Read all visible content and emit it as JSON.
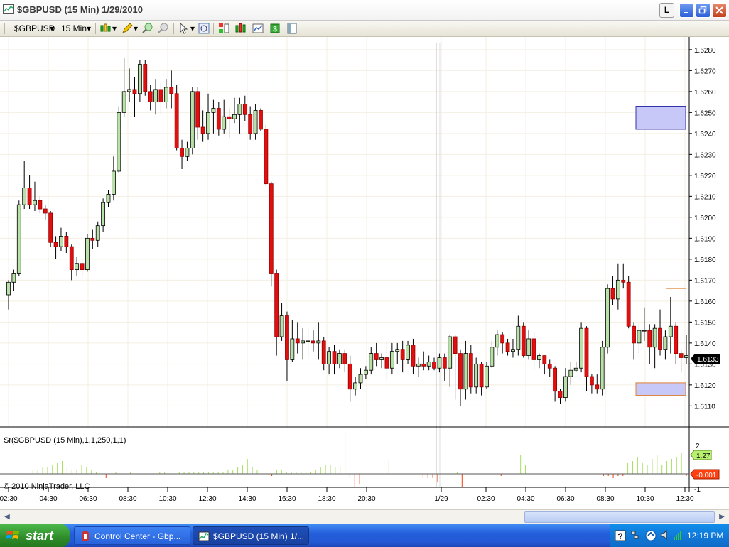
{
  "window": {
    "title": "$GBPUSD (15 Min)  1/29/2010",
    "btn_l": "L"
  },
  "toolbar": {
    "instrument": "$GBPUSD",
    "interval": "15 Min"
  },
  "indicator": {
    "label": "Sr($GBPUSD (15 Min),1,1,250,1,1)",
    "copyright": "© 2010 NinjaTrader, LLC",
    "axis_labels": [
      "2",
      "0",
      "-1"
    ],
    "upper_value": "1.27",
    "lower_value": "-0.001"
  },
  "price_axis": {
    "labels": [
      "1.6280",
      "1.6270",
      "1.6260",
      "1.6250",
      "1.6240",
      "1.6230",
      "1.6220",
      "1.6210",
      "1.6200",
      "1.6190",
      "1.6180",
      "1.6170",
      "1.6160",
      "1.6150",
      "1.6140",
      "1.6130",
      "1.6120",
      "1.6110"
    ],
    "current_price": "1.6133"
  },
  "time_axis": {
    "labels": [
      "02:30",
      "04:30",
      "06:30",
      "08:30",
      "10:30",
      "12:30",
      "14:30",
      "16:30",
      "18:30",
      "20:30",
      "1/29",
      "02:30",
      "04:30",
      "06:30",
      "08:30",
      "10:30",
      "12:30"
    ]
  },
  "chart_data": {
    "type": "candlestick",
    "y_range": [
      1.6103,
      1.6283
    ],
    "up_color": "#B8E0A8",
    "down_color": "#E01010",
    "candles": [
      [
        1.6163,
        1.6169,
        1.6156,
        1.617
      ],
      [
        1.6169,
        1.6173,
        1.6165,
        1.6175
      ],
      [
        1.6173,
        1.6206,
        1.6172,
        1.6208
      ],
      [
        1.6206,
        1.6214,
        1.6204,
        1.6227
      ],
      [
        1.6214,
        1.6206,
        1.6204,
        1.622
      ],
      [
        1.6206,
        1.6208,
        1.6203,
        1.6217
      ],
      [
        1.6208,
        1.6204,
        1.6202,
        1.621
      ],
      [
        1.6204,
        1.6202,
        1.6199,
        1.6206
      ],
      [
        1.6202,
        1.6188,
        1.6186,
        1.6203
      ],
      [
        1.6188,
        1.6186,
        1.618,
        1.6191
      ],
      [
        1.6186,
        1.6191,
        1.6184,
        1.6195
      ],
      [
        1.6191,
        1.6186,
        1.6183,
        1.6193
      ],
      [
        1.6186,
        1.6175,
        1.617,
        1.6187
      ],
      [
        1.6175,
        1.6178,
        1.6172,
        1.6181
      ],
      [
        1.6178,
        1.6175,
        1.6172,
        1.618
      ],
      [
        1.6175,
        1.619,
        1.6174,
        1.6192
      ],
      [
        1.619,
        1.6189,
        1.6185,
        1.6194
      ],
      [
        1.6189,
        1.6196,
        1.6186,
        1.6198
      ],
      [
        1.6196,
        1.6207,
        1.6193,
        1.6209
      ],
      [
        1.6207,
        1.6211,
        1.6205,
        1.6213
      ],
      [
        1.6211,
        1.6222,
        1.6208,
        1.6229
      ],
      [
        1.6222,
        1.625,
        1.6221,
        1.6253
      ],
      [
        1.625,
        1.626,
        1.6248,
        1.6276
      ],
      [
        1.626,
        1.6261,
        1.6255,
        1.6271
      ],
      [
        1.6261,
        1.6259,
        1.6248,
        1.6267
      ],
      [
        1.6259,
        1.6273,
        1.6255,
        1.6275
      ],
      [
        1.6273,
        1.626,
        1.6258,
        1.6275
      ],
      [
        1.626,
        1.6255,
        1.6251,
        1.6263
      ],
      [
        1.6255,
        1.6261,
        1.6249,
        1.6266
      ],
      [
        1.6261,
        1.6255,
        1.6249,
        1.6264
      ],
      [
        1.6255,
        1.6262,
        1.6252,
        1.6266
      ],
      [
        1.6262,
        1.6259,
        1.6252,
        1.627
      ],
      [
        1.6259,
        1.6233,
        1.6232,
        1.6263
      ],
      [
        1.6233,
        1.6229,
        1.6223,
        1.6237
      ],
      [
        1.6229,
        1.6233,
        1.6227,
        1.6236
      ],
      [
        1.6233,
        1.626,
        1.623,
        1.6262
      ],
      [
        1.626,
        1.6243,
        1.6237,
        1.6262
      ],
      [
        1.6243,
        1.624,
        1.6236,
        1.6251
      ],
      [
        1.624,
        1.625,
        1.6237,
        1.6259
      ],
      [
        1.625,
        1.6252,
        1.624,
        1.6256
      ],
      [
        1.6252,
        1.6242,
        1.6239,
        1.6255
      ],
      [
        1.6242,
        1.6248,
        1.624,
        1.6256
      ],
      [
        1.6248,
        1.6247,
        1.6238,
        1.6252
      ],
      [
        1.6247,
        1.6249,
        1.6245,
        1.6257
      ],
      [
        1.6249,
        1.6254,
        1.624,
        1.6257
      ],
      [
        1.6254,
        1.6249,
        1.6246,
        1.6258
      ],
      [
        1.6249,
        1.624,
        1.6237,
        1.6253
      ],
      [
        1.624,
        1.6251,
        1.6237,
        1.6254
      ],
      [
        1.6251,
        1.6242,
        1.6241,
        1.6252
      ],
      [
        1.6242,
        1.6216,
        1.6215,
        1.6244
      ],
      [
        1.6216,
        1.6173,
        1.6167,
        1.6217
      ],
      [
        1.6173,
        1.6143,
        1.6134,
        1.6175
      ],
      [
        1.6143,
        1.6153,
        1.6141,
        1.6159
      ],
      [
        1.6153,
        1.6132,
        1.6122,
        1.6155
      ],
      [
        1.6132,
        1.6142,
        1.6131,
        1.6151
      ],
      [
        1.6142,
        1.614,
        1.6135,
        1.615
      ],
      [
        1.614,
        1.6141,
        1.6132,
        1.6147
      ],
      [
        1.6141,
        1.6141,
        1.6133,
        1.6147
      ],
      [
        1.6141,
        1.614,
        1.6136,
        1.6146
      ],
      [
        1.614,
        1.6141,
        1.6132,
        1.615
      ],
      [
        1.6141,
        1.613,
        1.6127,
        1.6143
      ],
      [
        1.613,
        1.6136,
        1.6125,
        1.6138
      ],
      [
        1.6136,
        1.613,
        1.6125,
        1.6139
      ],
      [
        1.613,
        1.6135,
        1.6128,
        1.6137
      ],
      [
        1.6135,
        1.613,
        1.6126,
        1.6137
      ],
      [
        1.613,
        1.6118,
        1.6112,
        1.6134
      ],
      [
        1.6118,
        1.6121,
        1.6115,
        1.6124
      ],
      [
        1.6121,
        1.6125,
        1.6118,
        1.6128
      ],
      [
        1.6125,
        1.6127,
        1.6123,
        1.6129
      ],
      [
        1.6127,
        1.6135,
        1.6125,
        1.6138
      ],
      [
        1.6135,
        1.6132,
        1.6129,
        1.614
      ],
      [
        1.6132,
        1.6133,
        1.6128,
        1.6135
      ],
      [
        1.6133,
        1.6128,
        1.6122,
        1.6141
      ],
      [
        1.6128,
        1.6136,
        1.6125,
        1.614
      ],
      [
        1.6136,
        1.6137,
        1.613,
        1.614
      ],
      [
        1.6137,
        1.6132,
        1.6126,
        1.6141
      ],
      [
        1.6132,
        1.6139,
        1.613,
        1.6141
      ],
      [
        1.6139,
        1.6129,
        1.6125,
        1.6142
      ],
      [
        1.6129,
        1.613,
        1.6124,
        1.6133
      ],
      [
        1.613,
        1.6129,
        1.6127,
        1.6136
      ],
      [
        1.6129,
        1.6131,
        1.6127,
        1.6134
      ],
      [
        1.6131,
        1.6128,
        1.6127,
        1.6133
      ],
      [
        1.6128,
        1.6133,
        1.6126,
        1.6135
      ],
      [
        1.6133,
        1.6128,
        1.6122,
        1.6135
      ],
      [
        1.6128,
        1.6143,
        1.6119,
        1.6144
      ],
      [
        1.6143,
        1.6135,
        1.6113,
        1.6144
      ],
      [
        1.6135,
        1.6118,
        1.611,
        1.6137
      ],
      [
        1.6118,
        1.6135,
        1.6113,
        1.6141
      ],
      [
        1.6135,
        1.6119,
        1.6116,
        1.6139
      ],
      [
        1.6119,
        1.613,
        1.6116,
        1.6133
      ],
      [
        1.613,
        1.6119,
        1.6115,
        1.6131
      ],
      [
        1.6119,
        1.6129,
        1.6118,
        1.6131
      ],
      [
        1.6129,
        1.6138,
        1.6128,
        1.6141
      ],
      [
        1.6138,
        1.6144,
        1.6134,
        1.6146
      ],
      [
        1.6144,
        1.614,
        1.6135,
        1.6145
      ],
      [
        1.614,
        1.6136,
        1.6134,
        1.6142
      ],
      [
        1.6136,
        1.6137,
        1.6133,
        1.6142
      ],
      [
        1.6137,
        1.6148,
        1.6134,
        1.6153
      ],
      [
        1.6148,
        1.6134,
        1.6133,
        1.615
      ],
      [
        1.6134,
        1.6142,
        1.6132,
        1.6146
      ],
      [
        1.6142,
        1.6132,
        1.6127,
        1.6145
      ],
      [
        1.6132,
        1.6134,
        1.6128,
        1.6135
      ],
      [
        1.6134,
        1.613,
        1.6125,
        1.6134
      ],
      [
        1.613,
        1.6128,
        1.6124,
        1.6132
      ],
      [
        1.6128,
        1.6117,
        1.6112,
        1.6129
      ],
      [
        1.6117,
        1.6114,
        1.6111,
        1.6118
      ],
      [
        1.6114,
        1.6124,
        1.6112,
        1.6128
      ],
      [
        1.6124,
        1.6127,
        1.612,
        1.6131
      ],
      [
        1.6127,
        1.6128,
        1.6126,
        1.6131
      ],
      [
        1.6128,
        1.6147,
        1.6126,
        1.615
      ],
      [
        1.6147,
        1.6124,
        1.6117,
        1.6148
      ],
      [
        1.6124,
        1.612,
        1.6116,
        1.6125
      ],
      [
        1.612,
        1.6118,
        1.6116,
        1.6125
      ],
      [
        1.6118,
        1.6138,
        1.6115,
        1.6141
      ],
      [
        1.6138,
        1.6166,
        1.6135,
        1.6168
      ],
      [
        1.6166,
        1.6161,
        1.6158,
        1.6172
      ],
      [
        1.6161,
        1.617,
        1.6156,
        1.6178
      ],
      [
        1.617,
        1.6169,
        1.6166,
        1.6178
      ],
      [
        1.6169,
        1.6148,
        1.6147,
        1.6172
      ],
      [
        1.6148,
        1.614,
        1.6132,
        1.615
      ],
      [
        1.614,
        1.6146,
        1.6135,
        1.6149
      ],
      [
        1.6146,
        1.6146,
        1.6141,
        1.6157
      ],
      [
        1.6146,
        1.6138,
        1.613,
        1.6149
      ],
      [
        1.6138,
        1.6147,
        1.6128,
        1.6149
      ],
      [
        1.6147,
        1.6137,
        1.6134,
        1.6156
      ],
      [
        1.6137,
        1.6143,
        1.6132,
        1.6146
      ],
      [
        1.6143,
        1.6148,
        1.6135,
        1.6162
      ],
      [
        1.6148,
        1.6135,
        1.613,
        1.615
      ],
      [
        1.6135,
        1.6133,
        1.6126,
        1.6137
      ],
      [
        1.6133,
        1.6134,
        1.613,
        1.6144
      ]
    ],
    "zones": [
      {
        "top": 1.6253,
        "bottom": 1.6242
      },
      {
        "top": 1.6121,
        "bottom": 1.6115
      }
    ],
    "marker_price": 1.6166,
    "indicator_values": [
      0,
      0,
      0,
      0.1,
      0.1,
      0.2,
      0.2,
      0.3,
      0.3,
      0.4,
      0.5,
      0.6,
      0.3,
      0.2,
      0.2,
      0.4,
      0.3,
      0.2,
      0.1,
      0,
      -0.2,
      0,
      0.1,
      0,
      0,
      0.1,
      0,
      0,
      0,
      0,
      0,
      0.1,
      0.1,
      0,
      0,
      0.1,
      0.1,
      0.1,
      0.1,
      0.1,
      0.1,
      0.1,
      0.1,
      0.1,
      0.1,
      0.2,
      0.2,
      0.3,
      0.4,
      0.7,
      0.3,
      0.2,
      0,
      0,
      -0.1,
      0.2,
      0.2,
      0.1,
      0.1,
      0.1,
      0.1,
      0.1,
      0.1,
      0.2,
      0.3,
      0.4,
      0.4,
      0.3,
      0.3,
      2.0,
      -0.2,
      -0.6,
      -0.5,
      0,
      0,
      0,
      0,
      0.2,
      0.6,
      0,
      0,
      0,
      0,
      0,
      -0.3,
      -0.2,
      -0.2,
      -0.2,
      -0.4,
      0,
      0,
      0,
      0.1,
      -0.6,
      0,
      0,
      0,
      0,
      0,
      0,
      0,
      -0.1,
      0,
      0,
      0,
      0.9,
      0.4,
      0,
      0,
      0,
      0,
      0,
      0,
      0,
      0,
      0,
      0,
      0,
      0,
      0,
      0,
      0,
      -0.1,
      -0.1,
      -0.2,
      -0.1,
      -0.1,
      0.5,
      0.6,
      0.8,
      0.5,
      0.4,
      0.7,
      0.9,
      0.4,
      0.6,
      0.7,
      0.8,
      1.0,
      -0.1
    ]
  },
  "taskbar": {
    "start": "start",
    "tasks": [
      "Control Center - Gbp...",
      "$GBPUSD (15 Min)  1/..."
    ],
    "clock": "12:19 PM"
  }
}
